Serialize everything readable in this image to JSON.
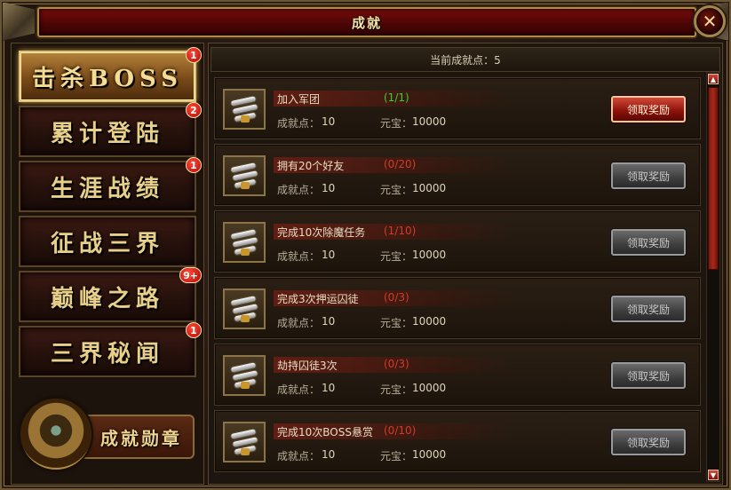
{
  "window": {
    "title": "成就"
  },
  "sidebar": {
    "tabs": [
      {
        "label": "击杀BOSS",
        "badge": "1",
        "active": true
      },
      {
        "label": "累计登陆",
        "badge": "2",
        "active": false
      },
      {
        "label": "生涯战绩",
        "badge": "1",
        "active": false
      },
      {
        "label": "征战三界",
        "badge": "",
        "active": false
      },
      {
        "label": "巅峰之路",
        "badge": "9+",
        "active": false
      },
      {
        "label": "三界秘闻",
        "badge": "1",
        "active": false
      }
    ],
    "medal_label": "成就勋章"
  },
  "main": {
    "points_text": "当前成就点：5",
    "rows": [
      {
        "name": "加入军团",
        "progress": "(1/1)",
        "done": true,
        "pts_label": "成就点：",
        "pts": "10",
        "yb_label": "元宝：",
        "yb": "10000",
        "button": "领取奖励",
        "enabled": true
      },
      {
        "name": "拥有20个好友",
        "progress": "(0/20)",
        "done": false,
        "pts_label": "成就点：",
        "pts": "10",
        "yb_label": "元宝：",
        "yb": "10000",
        "button": "领取奖励",
        "enabled": false
      },
      {
        "name": "完成10次除魔任务",
        "progress": "(1/10)",
        "done": false,
        "pts_label": "成就点：",
        "pts": "10",
        "yb_label": "元宝：",
        "yb": "10000",
        "button": "领取奖励",
        "enabled": false
      },
      {
        "name": "完成3次押运囚徒",
        "progress": "(0/3)",
        "done": false,
        "pts_label": "成就点：",
        "pts": "10",
        "yb_label": "元宝：",
        "yb": "10000",
        "button": "领取奖励",
        "enabled": false
      },
      {
        "name": "劫持囚徒3次",
        "progress": "(0/3)",
        "done": false,
        "pts_label": "成就点：",
        "pts": "10",
        "yb_label": "元宝：",
        "yb": "10000",
        "button": "领取奖励",
        "enabled": false
      },
      {
        "name": "完成10次BOSS悬赏",
        "progress": "(0/10)",
        "done": false,
        "pts_label": "成就点：",
        "pts": "10",
        "yb_label": "元宝：",
        "yb": "10000",
        "button": "领取奖励",
        "enabled": false
      }
    ]
  },
  "icons": {
    "close": "close-icon",
    "scroll_item": "scroll-icon",
    "medal": "medal-icon"
  }
}
